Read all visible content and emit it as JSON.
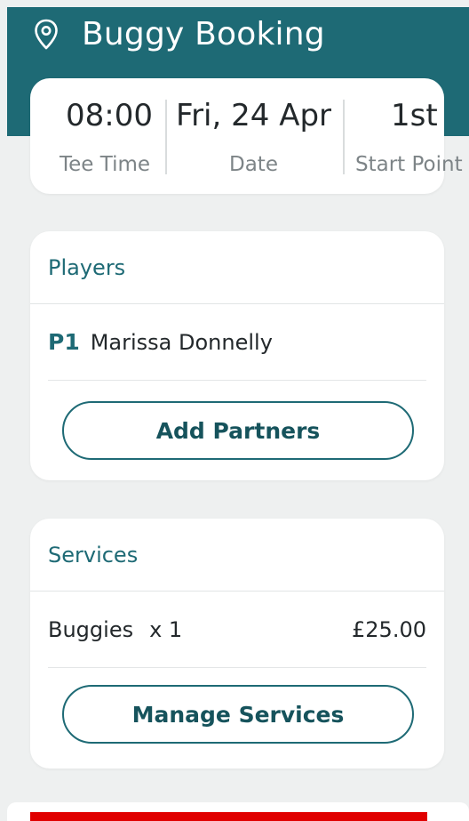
{
  "header": {
    "title": "Buggy Booking",
    "icon": "location-pin-icon"
  },
  "summary": {
    "tee_time": {
      "value": "08:00",
      "label": "Tee Time"
    },
    "date": {
      "value": "Fri, 24 Apr",
      "label": "Date"
    },
    "start_point": {
      "value": "1st",
      "label": "Start Point"
    }
  },
  "players": {
    "heading": "Players",
    "items": [
      {
        "tag": "P1",
        "name": "Marissa Donnelly"
      }
    ],
    "add_button_label": "Add Partners"
  },
  "services": {
    "heading": "Services",
    "items": [
      {
        "name": "Buggies",
        "qty": "x 1",
        "price": "£25.00"
      }
    ],
    "manage_button_label": "Manage Services"
  },
  "colors": {
    "brand": "#1e6a75",
    "background": "#eef0f0",
    "alert_bar": "#e00000"
  }
}
